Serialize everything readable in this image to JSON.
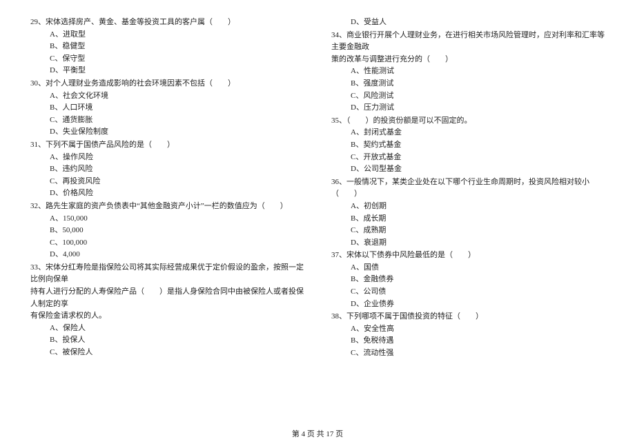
{
  "left": {
    "q29": {
      "stem": "29、宋体选择房产、黄金、基金等投资工具的客户属（　　）",
      "a": "A、进取型",
      "b": "B、稳健型",
      "c": "C、保守型",
      "d": "D、平衡型"
    },
    "q30": {
      "stem": "30、对个人理财业务造成影响的社会环境因素不包括（　　）",
      "a": "A、社会文化环境",
      "b": "B、人口环境",
      "c": "C、通货膨胀",
      "d": "D、失业保险制度"
    },
    "q31": {
      "stem": "31、下列不属于国债产品风险的是（　　）",
      "a": "A、操作风险",
      "b": "B、违约风险",
      "c": "C、再投资风险",
      "d": "D、价格风险"
    },
    "q32": {
      "stem": "32、路先生家庭的资产负债表中“其他金融资产小计”一栏的数值应为（　　）",
      "a": "A、150,000",
      "b": "B、50,000",
      "c": "C、100,000",
      "d": "D、4,000"
    },
    "q33": {
      "stem1": "33、宋体分红寿险是指保险公司将其实际经营成果优于定价假设的盈余，按照一定比例向保单",
      "stem2": "持有人进行分配的人寿保险产品（　　）是指人身保险合同中由被保险人或者投保人制定的享",
      "stem3": "有保险金请求权的人。",
      "a": "A、保险人",
      "b": "B、投保人",
      "c": "C、被保险人"
    }
  },
  "right": {
    "q33d": "D、受益人",
    "q34": {
      "stem1": "34、商业银行开展个人理财业务，在进行相关市场风险管理时，应对利率和汇率等主要金融政",
      "stem2": "策的改革与调整进行充分的（　　）",
      "a": "A、性能测试",
      "b": "B、强度测试",
      "c": "C、风险测试",
      "d": "D、压力测试"
    },
    "q35": {
      "stem": "35、（　　）的投资份额是可以不固定的。",
      "a": "A、封闭式基金",
      "b": "B、契约式基金",
      "c": "C、开放式基金",
      "d": "D、公司型基金"
    },
    "q36": {
      "stem": "36、一般情况下，某类企业处在以下哪个行业生命周期时，投资风险相对较小（　　）",
      "a": "A、初创期",
      "b": "B、成长期",
      "c": "C、成熟期",
      "d": "D、衰退期"
    },
    "q37": {
      "stem": "37、宋体以下债券中风险最低的是（　　）",
      "a": "A、国债",
      "b": "B、金融债券",
      "c": "C、公司债",
      "d": "D、企业债券"
    },
    "q38": {
      "stem": "38、下列哪项不属于国债投资的特征（　　）",
      "a": "A、安全性高",
      "b": "B、免税待遇",
      "c": "C、流动性强"
    }
  },
  "footer": "第 4 页 共 17 页"
}
